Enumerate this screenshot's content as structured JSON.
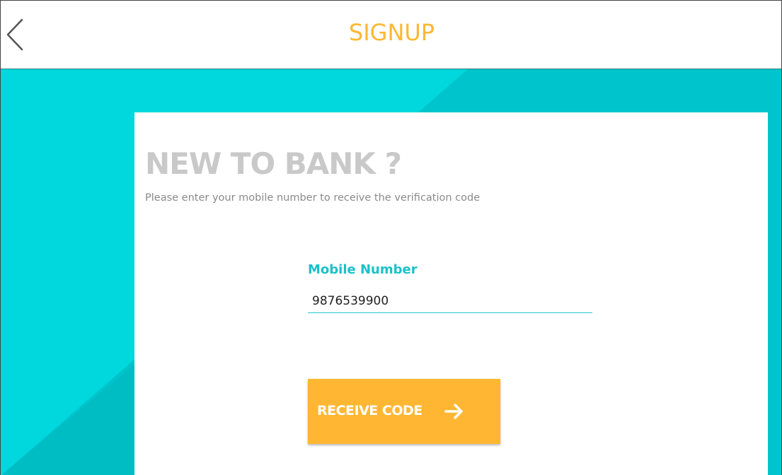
{
  "header": {
    "title": "SIGNUP",
    "back_icon": "chevron-left-icon"
  },
  "card": {
    "heading": "NEW TO BANK ?",
    "subtitle": "Please enter your mobile number to receive the verification code"
  },
  "form": {
    "mobile_label": "Mobile Number",
    "mobile_value": "9876539900"
  },
  "cta": {
    "label": "RECEIVE CODE",
    "icon": "arrow-right-icon"
  },
  "colors": {
    "accent": "#ffb733",
    "teal": "#00d8de",
    "teal_dark": "#00c1c8",
    "label_teal": "#19c1c9"
  }
}
